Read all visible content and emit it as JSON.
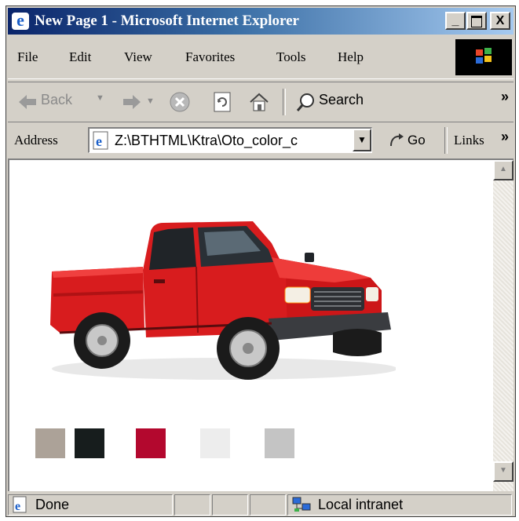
{
  "window": {
    "title": "New Page 1 - Microsoft Internet Explorer",
    "controls": {
      "minimize": "_",
      "maximize": "□",
      "close": "X"
    }
  },
  "menu": {
    "items": [
      {
        "label": "File"
      },
      {
        "label": "Edit"
      },
      {
        "label": "View"
      },
      {
        "label": "Favorites"
      },
      {
        "label": "Tools"
      },
      {
        "label": "Help"
      }
    ]
  },
  "toolbar": {
    "back_label": "Back",
    "search_label": "Search",
    "more": "»"
  },
  "address_bar": {
    "label": "Address",
    "value": "Z:\\BTHTML\\Ktra\\Oto_color_c",
    "go_label": "Go",
    "links_label": "Links",
    "links_more": "»"
  },
  "content": {
    "image_subject": "red pickup truck",
    "colors": {
      "truck_body": "#d81c1e",
      "accent": "#c00a2e"
    },
    "swatches": [
      {
        "name": "tan",
        "color": "#aca298"
      },
      {
        "name": "black",
        "color": "#171d1d"
      },
      {
        "name": "red",
        "color": "#b3082e"
      },
      {
        "name": "white",
        "color": "#ededed"
      },
      {
        "name": "silver",
        "color": "#c4c4c4"
      }
    ]
  },
  "status_bar": {
    "status": "Done",
    "zone": "Local intranet"
  },
  "icons": [
    "ie-logo-icon",
    "back-arrow-icon",
    "forward-arrow-icon",
    "stop-icon",
    "refresh-icon",
    "home-icon",
    "search-icon",
    "go-arrow-icon",
    "dropdown-icon",
    "windows-logo-icon",
    "local-intranet-icon",
    "scroll-up-icon",
    "scroll-down-icon"
  ]
}
